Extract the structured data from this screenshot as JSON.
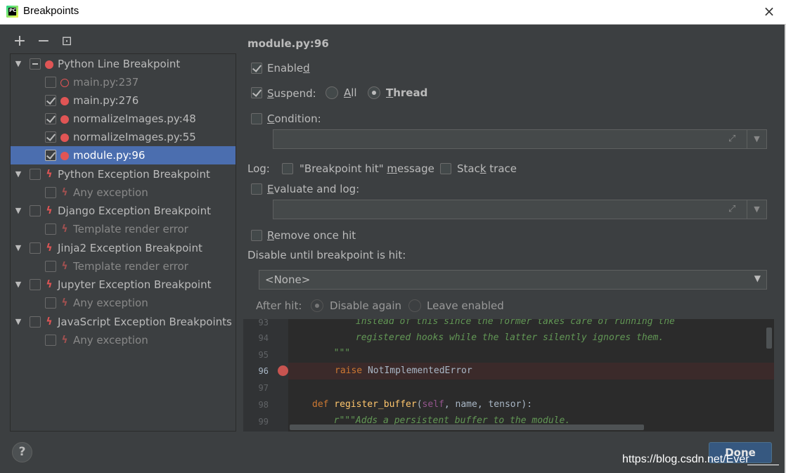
{
  "window": {
    "title": "Breakpoints",
    "close_icon": "×"
  },
  "toolbar": {
    "add": "+",
    "remove": "−",
    "group": "⊡"
  },
  "tree": {
    "groups": [
      {
        "label": "Python Line Breakpoint",
        "kind": "dot",
        "state": "mixed",
        "items": [
          {
            "label": "main.py:237",
            "checked": false,
            "enabled": false
          },
          {
            "label": "main.py:276",
            "checked": true,
            "enabled": true
          },
          {
            "label": "normalizeImages.py:48",
            "checked": true,
            "enabled": true
          },
          {
            "label": "normalizeImages.py:55",
            "checked": true,
            "enabled": true
          },
          {
            "label": "module.py:96",
            "checked": true,
            "enabled": true,
            "selected": true
          }
        ]
      },
      {
        "label": "Python Exception Breakpoint",
        "kind": "bolt",
        "state": "off",
        "items": [
          {
            "label": "Any exception"
          }
        ]
      },
      {
        "label": "Django Exception Breakpoint",
        "kind": "bolt",
        "state": "off",
        "items": [
          {
            "label": "Template render error"
          }
        ]
      },
      {
        "label": "Jinja2 Exception Breakpoint",
        "kind": "bolt",
        "state": "off",
        "items": [
          {
            "label": "Template render error"
          }
        ]
      },
      {
        "label": "Jupyter Exception Breakpoint",
        "kind": "bolt",
        "state": "off",
        "items": [
          {
            "label": "Any exception"
          }
        ]
      },
      {
        "label": "JavaScript Exception Breakpoints",
        "kind": "bolt",
        "state": "off",
        "items": [
          {
            "label": "Any exception"
          }
        ]
      }
    ]
  },
  "detail": {
    "header": "module.py:96",
    "enabled_label_pre": "Enable",
    "enabled_label_u": "d",
    "enabled_label_post": "",
    "suspend_label_pre": "",
    "suspend_label_u": "S",
    "suspend_label_post": "uspend:",
    "all_label_u": "A",
    "all_label_post": "ll",
    "thread_label_u": "T",
    "thread_label_post": "hread",
    "condition_label_u": "C",
    "condition_label_post": "ondition:",
    "log_label": "Log:",
    "breakpoint_hit_pre": "\"Breakpoint hit\" ",
    "breakpoint_hit_u": "m",
    "breakpoint_hit_post": "essage",
    "stack_trace_pre": "Stac",
    "stack_trace_u": "k",
    "stack_trace_post": " trace",
    "evaluate_label_u": "E",
    "evaluate_label_post": "valuate and log:",
    "remove_label_u": "R",
    "remove_label_post": "emove once hit",
    "disable_until_label": "Disable until breakpoint is hit:",
    "disable_until_value": "<None>",
    "after_hit_label": "After hit:",
    "disable_again_label": "Disable again",
    "leave_enabled_label": "Leave enabled"
  },
  "editor": {
    "lines": [
      {
        "num": "93",
        "code": "            instead of this since the former takes care of running the"
      },
      {
        "num": "94",
        "code": "            registered hooks while the latter silently ignores them."
      },
      {
        "num": "95",
        "code": "        \"\"\""
      },
      {
        "num": "96",
        "kw": "raise",
        "rest": " NotImplementedError"
      },
      {
        "num": "97",
        "code": ""
      },
      {
        "num": "98",
        "def": "def",
        "fn": " register_buffer",
        "p1": "(",
        "self": "self",
        "args": ", name, tensor):"
      },
      {
        "num": "99",
        "doc": "        r\"\"\"Adds a persistent buffer to the module."
      }
    ]
  },
  "footer": {
    "help_label": "?",
    "done_label": "Done",
    "watermark": "https://blog.csdn.net/Ever"
  }
}
